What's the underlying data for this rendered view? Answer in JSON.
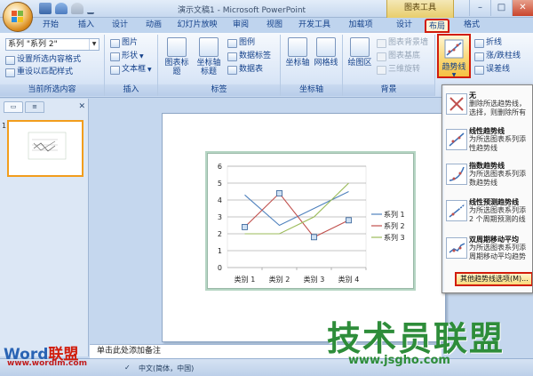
{
  "window": {
    "title": "演示文稿1 - Microsoft PowerPoint",
    "context_tools": "图表工具",
    "min": "–",
    "max": "□",
    "close": "✕"
  },
  "tabs": [
    "开始",
    "插入",
    "设计",
    "动画",
    "幻灯片放映",
    "审阅",
    "视图",
    "开发工具",
    "加载项",
    "设计",
    "布局",
    "格式"
  ],
  "ribbon": {
    "current_selection": {
      "label": "当前所选内容",
      "dropdown_value": "系列 \"系列 2\"",
      "format_selection": "设置所选内容格式",
      "reset_style": "重设以匹配样式"
    },
    "insert": {
      "label": "插入",
      "picture": "图片",
      "shapes": "形状",
      "textbox": "文本框"
    },
    "labels": {
      "label": "标签",
      "chart_title": "图表标题",
      "axis_titles": "坐标轴标题",
      "legend": "图例",
      "data_labels": "数据标签",
      "data_table": "数据表"
    },
    "axes": {
      "label": "坐标轴",
      "axes": "坐标轴",
      "gridlines": "网格线"
    },
    "background": {
      "label": "背景",
      "plot_area": "绘图区",
      "chart_wall": "图表背景墙",
      "chart_floor": "图表基底",
      "rotation_3d": "三维旋转"
    },
    "analysis": {
      "trendline": "趋势线",
      "lines": "折线",
      "updown_bars": "涨/跌柱线",
      "error_bars": "误差线"
    }
  },
  "left_panel": {
    "slide_number": "1"
  },
  "notes_placeholder": "单击此处添加备注",
  "status_bar": {
    "language": "中文(简体，中国)"
  },
  "trend_menu": {
    "items": [
      {
        "title": "无",
        "desc1": "删除所选趋势线，",
        "desc2": "选择，则删除所有"
      },
      {
        "title": "线性趋势线",
        "desc1": "为所选图表系列添",
        "desc2": "性趋势线"
      },
      {
        "title": "指数趋势线",
        "desc1": "为所选图表系列添",
        "desc2": "数趋势线"
      },
      {
        "title": "线性预测趋势线",
        "desc1": "为所选图表系列添",
        "desc2": "2 个周期预测的线"
      },
      {
        "title": "双周期移动平均",
        "desc1": "为所选图表系列添",
        "desc2": "周期移动平均趋势"
      }
    ],
    "more_options": "其他趋势线选项(M)..."
  },
  "chart_data": {
    "type": "line",
    "categories": [
      "类别 1",
      "类别 2",
      "类别 3",
      "类别 4"
    ],
    "series": [
      {
        "name": "系列 1",
        "values": [
          4.3,
          2.5,
          3.5,
          4.5
        ],
        "color": "#4f81bd"
      },
      {
        "name": "系列 2",
        "values": [
          2.4,
          4.4,
          1.8,
          2.8
        ],
        "color": "#c0504d"
      },
      {
        "name": "系列 3",
        "values": [
          2,
          2,
          3,
          5
        ],
        "color": "#9bbb59"
      }
    ],
    "yticks": [
      "0",
      "1",
      "2",
      "3",
      "4",
      "5",
      "6"
    ],
    "ylim": [
      0,
      6
    ],
    "legend_position": "right",
    "selected_series": "系列 2",
    "grid": true
  },
  "watermarks": {
    "word_logo_a": "Word",
    "word_logo_b": "联盟",
    "word_url": "www.wordlm.com",
    "jsg_text": "技术员联盟",
    "jsg_url": "www.jsgho.com"
  },
  "colors": {
    "highlight_red": "#d11c0b",
    "ribbon_blue": "#15428b"
  }
}
